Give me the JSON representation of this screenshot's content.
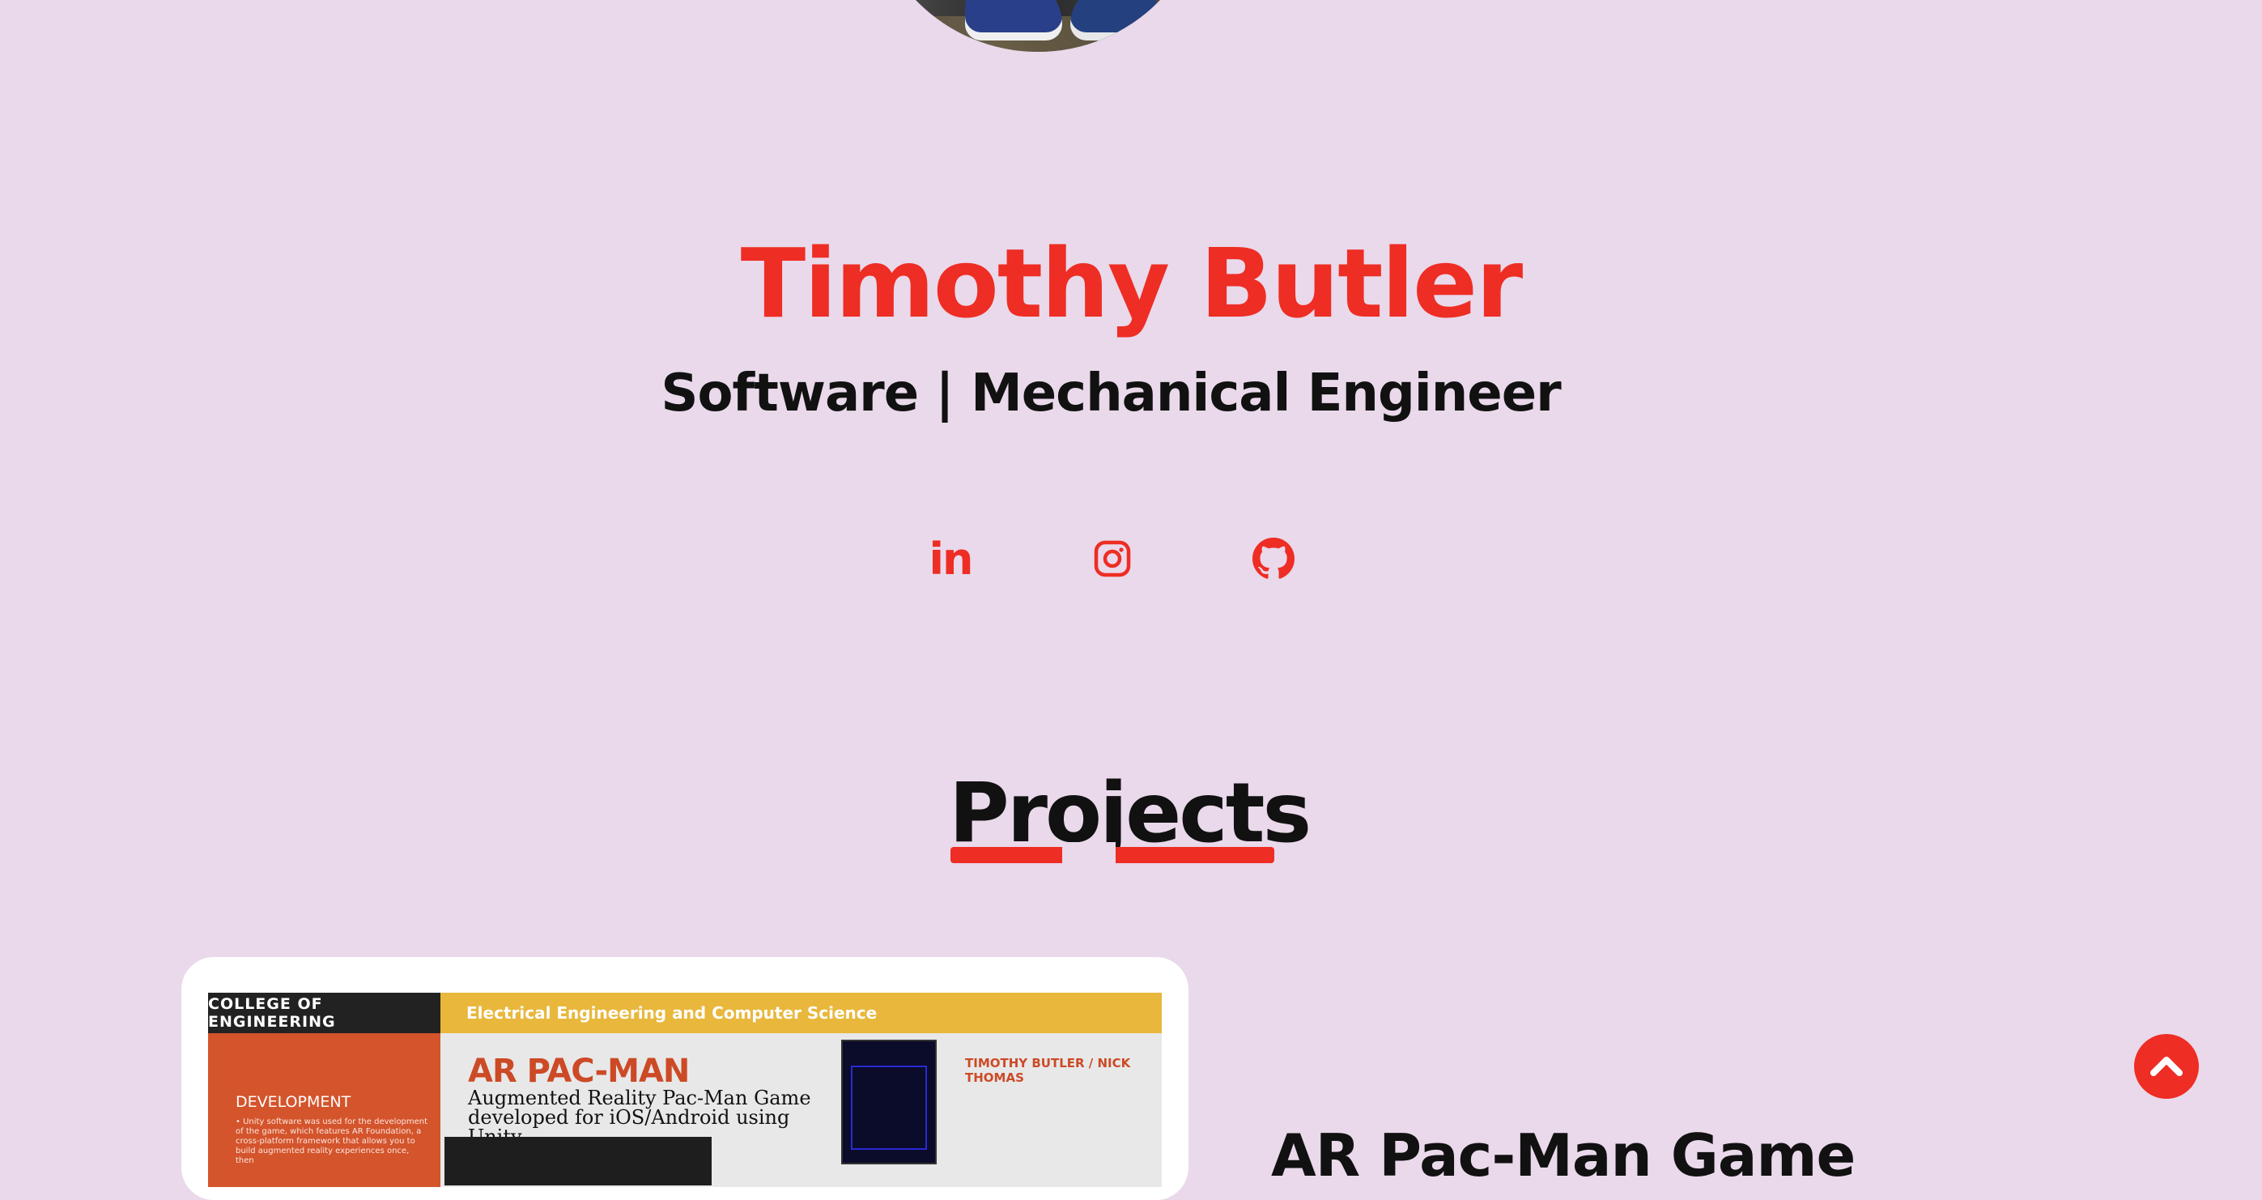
{
  "hero": {
    "name": "Timothy Butler",
    "subtitle": "Software | Mechanical Engineer"
  },
  "socials": [
    {
      "label": "in",
      "icon": "linkedin-icon"
    },
    {
      "icon": "instagram-icon"
    },
    {
      "icon": "github-icon"
    }
  ],
  "projects": {
    "heading": "Projects",
    "items": [
      {
        "title": "AR Pac-Man Game",
        "poster": {
          "college": "COLLEGE OF ENGINEERING",
          "department": "Electrical Engineering and Computer Science",
          "title": "AR PAC-MAN",
          "subtitle": "Augmented Reality Pac-Man Game developed for iOS/Android using Unity",
          "authors": "TIMOTHY BUTLER / NICK THOMAS",
          "section_heading": "DEVELOPMENT",
          "section_text": "• Unity software was used for the development of the game, which features AR Foundation, a cross-platform framework that allows you to build augmented reality experiences once, then"
        }
      }
    ]
  },
  "colors": {
    "background": "#e9d9ea",
    "accent": "#ee2d24",
    "text": "#111111"
  }
}
